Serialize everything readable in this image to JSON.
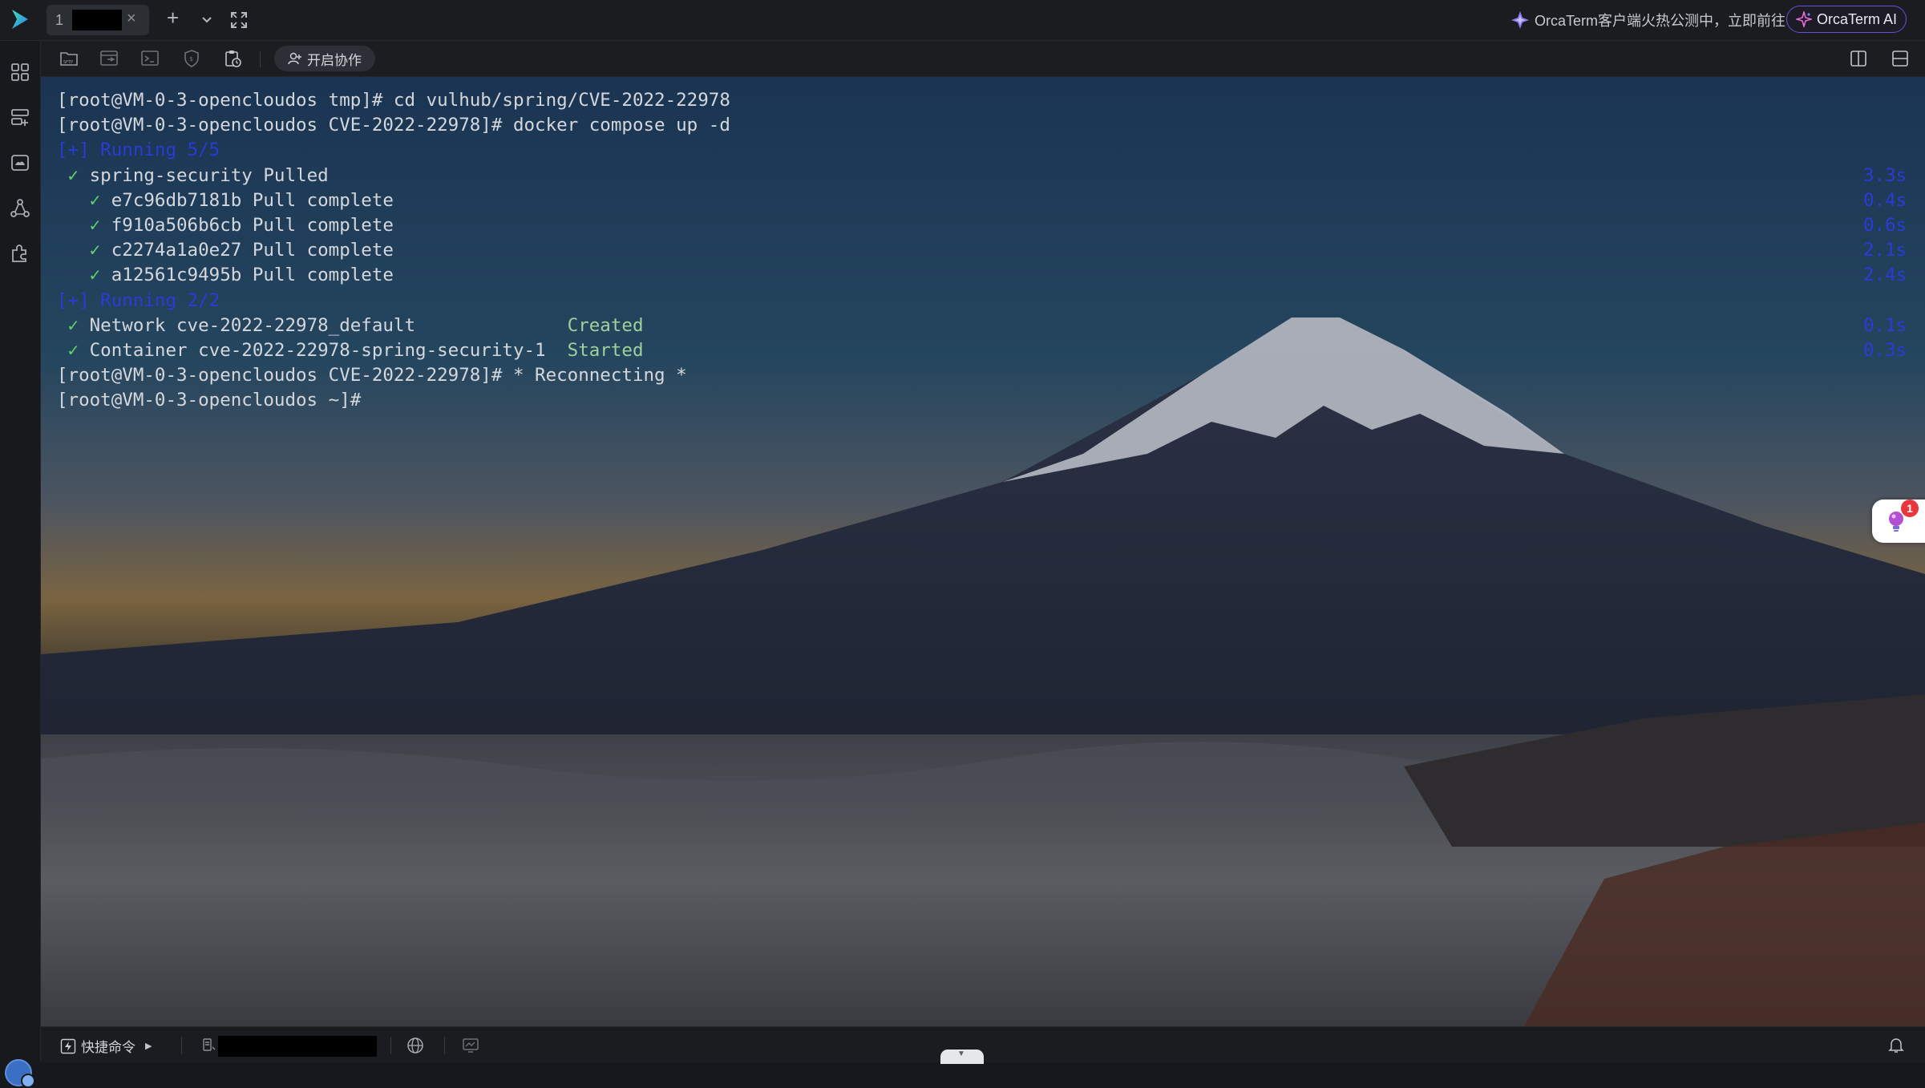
{
  "tabbar": {
    "tab_number": "1",
    "tab_close": "×",
    "new_tab": "+",
    "tab_dropdown": "⌄",
    "announcement": "OrcaTerm客户端火热公测中，立即前往",
    "ai_button": "OrcaTerm AI"
  },
  "toolbar": {
    "collab_button": "开启协作",
    "icons": [
      "sftp-icon",
      "file-transfer-icon",
      "terminal-icon",
      "shield-icon",
      "clipboard-icon"
    ]
  },
  "sidebar": {
    "icons": [
      "apps-grid-icon",
      "server-list-icon",
      "cloud-storage-icon",
      "network-icon",
      "plugin-icon"
    ]
  },
  "terminal": {
    "lines": [
      {
        "parts": [
          {
            "t": "[root@VM-0-3-opencloudos tmp]# cd vulhub/spring/CVE-2022-22978",
            "c": ""
          }
        ],
        "time": ""
      },
      {
        "parts": [
          {
            "t": "[root@VM-0-3-opencloudos CVE-2022-22978]# docker compose up -d",
            "c": ""
          }
        ],
        "time": ""
      },
      {
        "parts": [
          {
            "t": "[+] Running 5/5",
            "c": "blue"
          }
        ],
        "time": ""
      },
      {
        "parts": [
          {
            "t": " ",
            "c": ""
          },
          {
            "t": "✓",
            "c": "check"
          },
          {
            "t": " spring-security Pulled",
            "c": ""
          }
        ],
        "time": "3.3s"
      },
      {
        "parts": [
          {
            "t": "   ",
            "c": ""
          },
          {
            "t": "✓",
            "c": "check"
          },
          {
            "t": " e7c96db7181b Pull complete",
            "c": ""
          }
        ],
        "time": "0.4s"
      },
      {
        "parts": [
          {
            "t": "   ",
            "c": ""
          },
          {
            "t": "✓",
            "c": "check"
          },
          {
            "t": " f910a506b6cb Pull complete",
            "c": ""
          }
        ],
        "time": "0.6s"
      },
      {
        "parts": [
          {
            "t": "   ",
            "c": ""
          },
          {
            "t": "✓",
            "c": "check"
          },
          {
            "t": " c2274a1a0e27 Pull complete",
            "c": ""
          }
        ],
        "time": "2.1s"
      },
      {
        "parts": [
          {
            "t": "   ",
            "c": ""
          },
          {
            "t": "✓",
            "c": "check"
          },
          {
            "t": " a12561c9495b Pull complete",
            "c": ""
          }
        ],
        "time": "2.4s"
      },
      {
        "parts": [
          {
            "t": "[+] Running 2/2",
            "c": "blue"
          }
        ],
        "time": ""
      },
      {
        "parts": [
          {
            "t": " ",
            "c": ""
          },
          {
            "t": "✓",
            "c": "check"
          },
          {
            "t": " Network cve-2022-22978_default              ",
            "c": ""
          },
          {
            "t": "Created",
            "c": "green"
          }
        ],
        "time": "0.1s"
      },
      {
        "parts": [
          {
            "t": " ",
            "c": ""
          },
          {
            "t": "✓",
            "c": "check"
          },
          {
            "t": " Container cve-2022-22978-spring-security-1  ",
            "c": ""
          },
          {
            "t": "Started",
            "c": "green"
          }
        ],
        "time": "0.3s"
      },
      {
        "parts": [
          {
            "t": "[root@VM-0-3-opencloudos CVE-2022-22978]# * Reconnecting *",
            "c": ""
          }
        ],
        "time": ""
      },
      {
        "parts": [
          {
            "t": "[root@VM-0-3-opencloudos ~]#",
            "c": ""
          }
        ],
        "time": ""
      }
    ],
    "notification_count": "1"
  },
  "statusbar": {
    "quick_commands": "快捷命令",
    "expand_arrow": "▶"
  },
  "colors": {
    "blue_text": "#2a3bd6",
    "green_text": "#9fd19b",
    "check": "#62d36a",
    "ai_border": "#6a4fd3",
    "badge_red": "#e8363c"
  }
}
